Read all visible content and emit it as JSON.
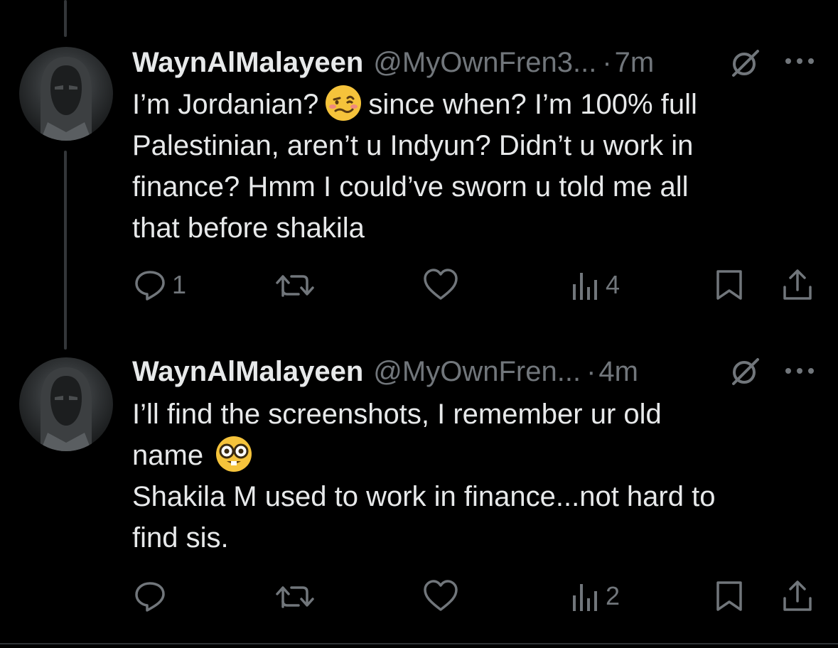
{
  "tweets": [
    {
      "author_name": "WaynAlMalayeen",
      "handle": "@MyOwnFren3...",
      "separator": "·",
      "time": "7m",
      "lines": [
        {
          "before": "I’m Jordanian?",
          "emoji": "woozy-face-icon",
          "after": "since when? I’m 100% full"
        },
        {
          "text": "Palestinian, aren’t u Indyun? Didn’t u work in"
        },
        {
          "text": "finance? Hmm I could’ve sworn u told me all"
        },
        {
          "text": "that before shakila"
        }
      ],
      "actions": {
        "replies": "1",
        "reposts": "",
        "likes": "",
        "views": "4"
      }
    },
    {
      "author_name": "WaynAlMalayeen",
      "handle": "@MyOwnFren...",
      "separator": "·",
      "time": "4m",
      "lines": [
        {
          "text": "I’ll find the screenshots, I remember ur old"
        },
        {
          "before": "name",
          "emoji": "nerd-face-icon",
          "after": ""
        },
        {
          "text": "Shakila M used to work in finance...not hard to"
        },
        {
          "text": "find sis."
        }
      ],
      "actions": {
        "replies": "",
        "reposts": "",
        "likes": "",
        "views": "2"
      }
    }
  ],
  "icons": {
    "grok": "grok-icon",
    "more": "more-options-icon",
    "reply": "reply-icon",
    "repost": "repost-icon",
    "like": "heart-icon",
    "views": "views-icon",
    "bookmark": "bookmark-icon",
    "share": "share-icon"
  },
  "colors": {
    "background": "#000000",
    "text": "#e7e9ea",
    "secondary": "#71767b",
    "thread_line": "#333639"
  }
}
